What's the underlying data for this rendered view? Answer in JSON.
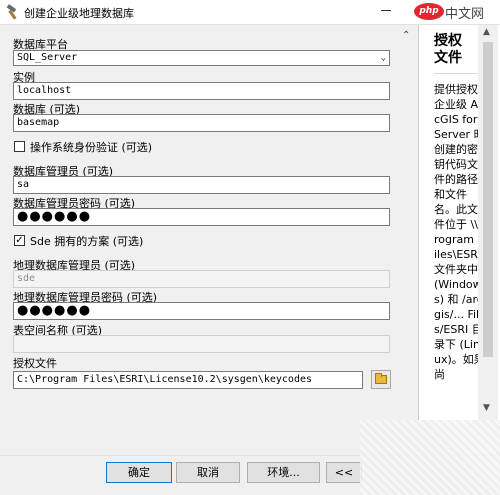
{
  "window": {
    "title": "创建企业级地理数据库"
  },
  "watermark": {
    "badge": "php",
    "text": "中文网"
  },
  "form": {
    "platform_label": "数据库平台",
    "platform_value": "SQL_Server",
    "instance_label": "实例",
    "instance_value": "localhost",
    "database_label": "数据库 (可选)",
    "database_value": "basemap",
    "os_auth_label": "操作系统身份验证 (可选)",
    "os_auth_checked": false,
    "dbadmin_label": "数据库管理员 (可选)",
    "dbadmin_value": "sa",
    "dbadmin_pw_label": "数据库管理员密码 (可选)",
    "dbadmin_pw_value": "●●●●●●",
    "sde_schema_label": "Sde 拥有的方案 (可选)",
    "sde_schema_checked": true,
    "gdb_admin_label": "地理数据库管理员 (可选)",
    "gdb_admin_value": "sde",
    "gdb_admin_pw_label": "地理数据库管理员密码 (可选)",
    "gdb_admin_pw_value": "●●●●●●",
    "tablespace_label": "表空间名称 (可选)",
    "tablespace_value": "",
    "auth_file_label": "授权文件",
    "auth_file_value": "C:\\Program Files\\ESRI\\License10.2\\sysgen\\keycodes"
  },
  "help": {
    "title": "授权文件",
    "body": "提供授权企业级 ArcGIS for Server 时创建的密钥代码文件的路径和文件名。此文件位于 \\\\Program Files\\ESRI 文件夹中 (Windows) 和 /arcgis/... Files/ESRI 目录下 (Linux)。如果尚"
  },
  "buttons": {
    "ok": "确定",
    "cancel": "取消",
    "env": "环境...",
    "hide": "<<"
  },
  "colors": {
    "focus_border": "#0078d7",
    "watermark_red": "#e3262e",
    "folder": "#e8b73c"
  }
}
